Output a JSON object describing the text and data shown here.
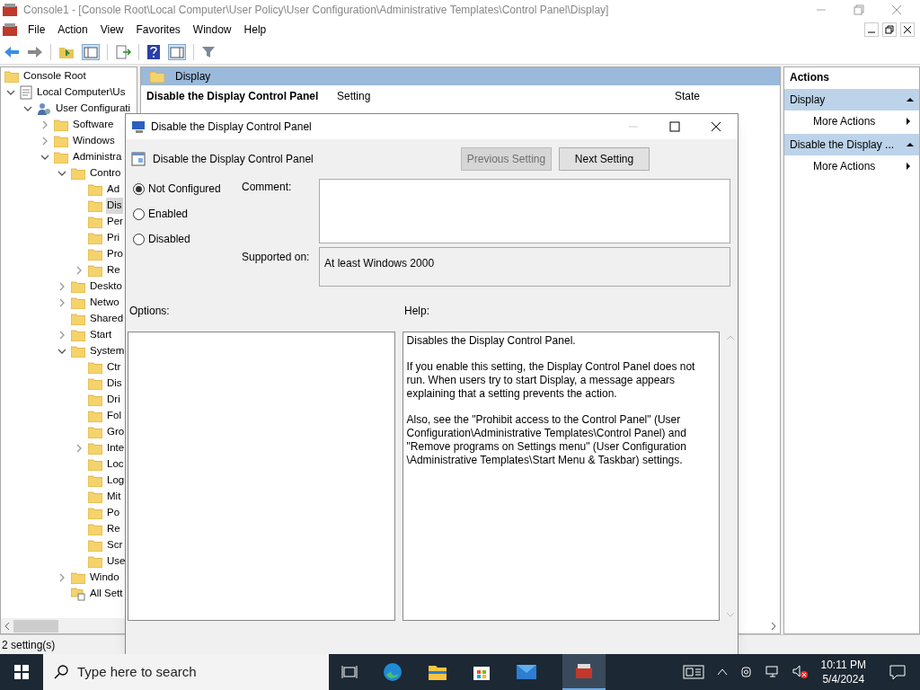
{
  "window": {
    "title": "Console1 - [Console Root\\Local Computer\\User Policy\\User Configuration\\Administrative Templates\\Control Panel\\Display]"
  },
  "menu": [
    "File",
    "Action",
    "View",
    "Favorites",
    "Window",
    "Help"
  ],
  "tree": [
    {
      "label": "Console Root",
      "kind": "folder",
      "children": [
        {
          "label": "Local Computer\\Us",
          "kind": "policy",
          "expanded": true,
          "children": [
            {
              "label": "User Configurati",
              "kind": "user",
              "expanded": true,
              "children": [
                {
                  "label": "Software",
                  "kind": "folder",
                  "expanded": false
                },
                {
                  "label": "Windows",
                  "kind": "folder",
                  "expanded": false
                },
                {
                  "label": "Administra",
                  "kind": "folder",
                  "expanded": true,
                  "children": [
                    {
                      "label": "Contro",
                      "kind": "folder",
                      "expanded": true,
                      "children": [
                        {
                          "label": "Ad",
                          "kind": "folder",
                          "selected": false
                        },
                        {
                          "label": "Dis",
                          "kind": "folder",
                          "selected": true
                        },
                        {
                          "label": "Per",
                          "kind": "folder",
                          "selected": false
                        },
                        {
                          "label": "Pri",
                          "kind": "folder",
                          "selected": false
                        },
                        {
                          "label": "Pro",
                          "kind": "folder",
                          "selected": false
                        },
                        {
                          "label": "Re",
                          "kind": "folder",
                          "selected": false,
                          "expanded": false
                        }
                      ]
                    },
                    {
                      "label": "Deskto",
                      "kind": "folder",
                      "expanded": false
                    },
                    {
                      "label": "Netwo",
                      "kind": "folder",
                      "expanded": false
                    },
                    {
                      "label": "Shared",
                      "kind": "folder"
                    },
                    {
                      "label": "Start",
                      "kind": "folder",
                      "expanded": false
                    },
                    {
                      "label": "System",
                      "kind": "folder",
                      "expanded": true,
                      "children": [
                        {
                          "label": "Ctr",
                          "kind": "folder"
                        },
                        {
                          "label": "Dis",
                          "kind": "folder"
                        },
                        {
                          "label": "Dri",
                          "kind": "folder"
                        },
                        {
                          "label": "Fol",
                          "kind": "folder"
                        },
                        {
                          "label": "Gro",
                          "kind": "folder"
                        },
                        {
                          "label": "Inte",
                          "kind": "folder",
                          "expanded": false
                        },
                        {
                          "label": "Loc",
                          "kind": "folder"
                        },
                        {
                          "label": "Log",
                          "kind": "folder"
                        },
                        {
                          "label": "Mit",
                          "kind": "folder"
                        },
                        {
                          "label": "Po",
                          "kind": "folder"
                        },
                        {
                          "label": "Re",
                          "kind": "folder"
                        },
                        {
                          "label": "Scr",
                          "kind": "folder"
                        },
                        {
                          "label": "Use",
                          "kind": "folder"
                        }
                      ]
                    },
                    {
                      "label": "Windo",
                      "kind": "folder",
                      "expanded": false
                    },
                    {
                      "label": "All Sett",
                      "kind": "allsettings"
                    }
                  ]
                }
              ]
            }
          ]
        }
      ]
    }
  ],
  "middle": {
    "header": "Display",
    "setting_title": "Disable the Display Control Panel",
    "columns": [
      "Setting",
      "State"
    ]
  },
  "actions": {
    "title": "Actions",
    "groups": [
      {
        "label": "Display",
        "item": "More Actions"
      },
      {
        "label": "Disable the Display ...",
        "item": "More Actions"
      }
    ]
  },
  "status_bar": "2 setting(s)",
  "dialog": {
    "title": "Disable the Display Control Panel",
    "policy_name": "Disable the Display Control Panel",
    "buttons": [
      {
        "label": "Previous Setting",
        "disabled": true
      },
      {
        "label": "Next Setting",
        "disabled": false
      }
    ],
    "options": [
      {
        "label": "Not Configured",
        "selected": true
      },
      {
        "label": "Enabled",
        "selected": false
      },
      {
        "label": "Disabled",
        "selected": false
      }
    ],
    "comment_label": "Comment:",
    "supported_label": "Supported on:",
    "supported_value": "At least Windows 2000",
    "options_label": "Options:",
    "help_label": "Help:",
    "help": [
      "Disables the Display Control Panel.",
      "If you enable this setting, the Display Control Panel does not run. When users try to start Display, a message appears explaining that a setting prevents the action.",
      "Also, see the \"Prohibit access to the Control Panel\" (User Configuration\\Administrative Templates\\Control Panel) and \"Remove programs on Settings menu\" (User Configuration \\Administrative Templates\\Start Menu & Taskbar) settings."
    ]
  },
  "taskbar": {
    "search_placeholder": "Type here to search",
    "time": "10:11 PM",
    "date": "5/4/2024"
  }
}
